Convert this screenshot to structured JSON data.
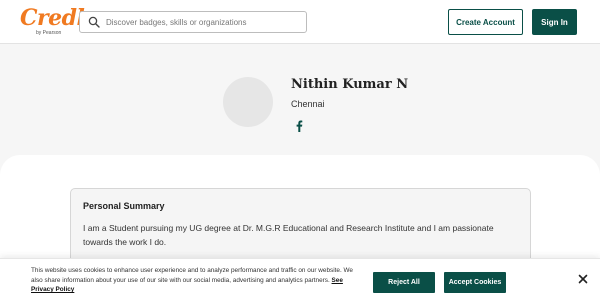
{
  "header": {
    "logo_text": "Credly",
    "logo_subtext": "by Pearson",
    "search_placeholder": "Discover badges, skills or organizations",
    "search_icon": "search-icon",
    "create_account_label": "Create Account",
    "sign_in_label": "Sign In"
  },
  "profile": {
    "name": "Nithin Kumar N",
    "location": "Chennai",
    "social_icons": [
      "facebook-icon"
    ]
  },
  "summary": {
    "title": "Personal Summary",
    "text": "I am a Student pursuing my UG degree at Dr. M.G.R Educational and Research Institute and I am passionate towards the work I do."
  },
  "cookie_banner": {
    "text": "This website uses cookies to enhance user experience and to analyze performance and traffic on our website. We also share information about your use of our site with our social media, advertising and analytics partners.",
    "privacy_link_label": "See Privacy Policy",
    "reject_label": "Reject All",
    "accept_label": "Accept Cookies",
    "close_icon": "close-icon"
  },
  "colors": {
    "brand_orange": "#f07a21",
    "primary_teal": "#0a4f47",
    "page_background": "#f6f6f6"
  }
}
